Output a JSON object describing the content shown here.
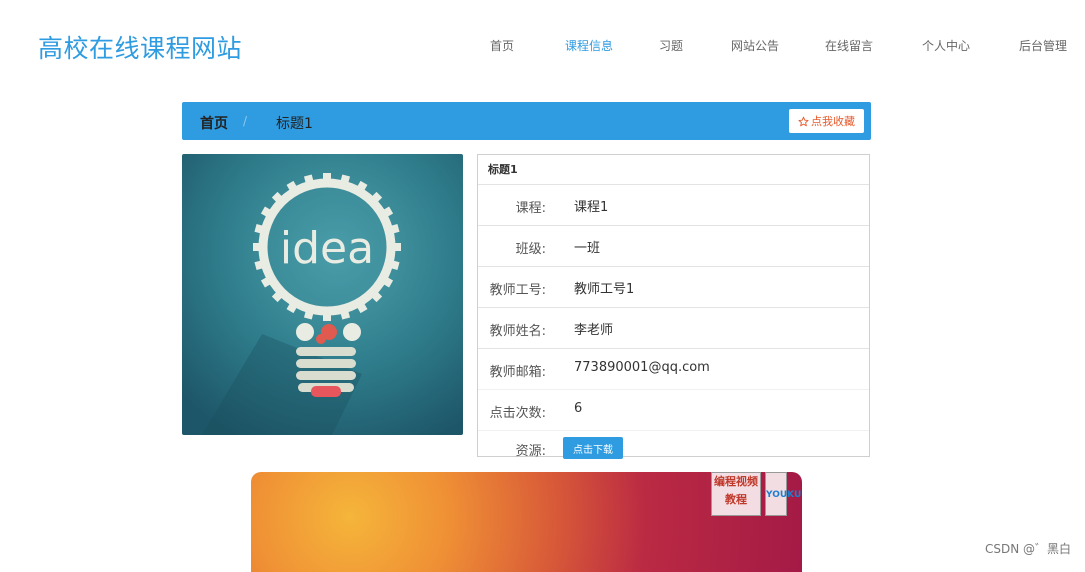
{
  "site": {
    "title": "高校在线课程网站"
  },
  "nav": {
    "items": [
      {
        "label": "首页"
      },
      {
        "label": "课程信息"
      },
      {
        "label": "习题"
      },
      {
        "label": "网站公告"
      },
      {
        "label": "在线留言"
      },
      {
        "label": "个人中心"
      },
      {
        "label": "后台管理"
      }
    ],
    "active_index": 1
  },
  "breadcrumb": {
    "home": "首页",
    "separator": "/",
    "current": "标题1"
  },
  "favorite": {
    "icon": "star-outline-icon",
    "label": "点我收藏"
  },
  "cover": {
    "text": "idea"
  },
  "details": {
    "title": "标题1",
    "rows": [
      {
        "label": "课程:",
        "value": "课程1"
      },
      {
        "label": "班级:",
        "value": "一班"
      },
      {
        "label": "教师工号:",
        "value": "教师工号1"
      },
      {
        "label": "教师姓名:",
        "value": "李老师"
      },
      {
        "label": "教师邮箱:",
        "value": "773890001@qq.com"
      },
      {
        "label": "点击次数:",
        "value": "6"
      }
    ],
    "resource_label": "资源:",
    "download_label": "点击下载"
  },
  "video": {
    "watermark_text": "编程视频教程",
    "watermark_brand": "YOUKU"
  },
  "credit": "CSDN @゛黑白",
  "colors": {
    "accent": "#2f9be0",
    "favorite_text": "#e65a2b"
  }
}
